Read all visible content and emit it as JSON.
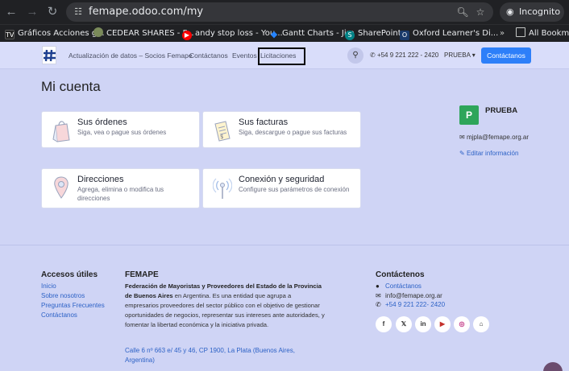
{
  "browser": {
    "url": "femape.odoo.com/my",
    "incognito_label": "Incognito",
    "bookmarks": [
      {
        "label": "Gráficos Acciones g...",
        "icon": "tradingview-icon",
        "color": "#222222"
      },
      {
        "label": "CEDEAR SHARES - P...",
        "icon": "globe-icon",
        "color": "#7a8a5a"
      },
      {
        "label": "andy stop loss - You...",
        "icon": "youtube-icon",
        "color": "#ff0000"
      },
      {
        "label": "Gantt Charts - Jira",
        "icon": "jira-icon",
        "color": "#2684ff"
      },
      {
        "label": "SharePoint",
        "icon": "sharepoint-icon",
        "color": "#038387"
      },
      {
        "label": "Oxford Learner's Di...",
        "icon": "oxford-icon",
        "color": "#1a3a6b"
      }
    ],
    "all_bookmarks_label": "All Bookmark"
  },
  "header": {
    "nav": [
      "Actualización de datos – Socios Femape",
      "Contáctanos",
      "Eventos",
      "Licitaciones"
    ],
    "phone": "+54 9 221 222 - 2420",
    "user": "PRUEBA",
    "cta": "Contáctanos"
  },
  "main": {
    "title": "Mi cuenta",
    "cards": [
      {
        "title": "Sus órdenes",
        "desc": "Siga, vea o pague sus órdenes",
        "icon": "orders-bag-icon"
      },
      {
        "title": "Sus facturas",
        "desc": "Siga, descargue o pague sus facturas",
        "icon": "invoice-icon"
      },
      {
        "title": "Direcciones",
        "desc": "Agrega, elimina o modifica tus direcciones",
        "icon": "map-pin-icon"
      },
      {
        "title": "Conexión y seguridad",
        "desc": "Configure sus parámetros de conexión",
        "icon": "security-antenna-icon"
      }
    ]
  },
  "profile": {
    "initial": "P",
    "name": "PRUEBA",
    "email": "mjpla@femape.org.ar",
    "edit": "Editar información",
    "avatar_color": "#2ea55a"
  },
  "footer": {
    "useful_title": "Accesos útiles",
    "useful_links": [
      "Inicio",
      "Sobre nosotros",
      "Preguntas Frecuentes",
      "Contáctanos"
    ],
    "org_title": "FEMAPE",
    "org_name": "Federación de Mayoristas y Proveedores del Estado de la Provincia de Buenos Aires",
    "org_desc": " en Argentina. Es una entidad que agrupa a empresarios proveedores del sector público con el objetivo de gestionar oportunidades de negocios, representar sus intereses ante autoridades, y fomentar la libertad económica y la iniciativa privada.",
    "address": "Calle 6 nº 663 e/ 45 y 46, CP 1900, La Plata (Buenos Aires, Argentina)",
    "contact_title": "Contáctenos",
    "contact_link": "Contáctanos",
    "contact_email": "info@femape.org.ar",
    "contact_phone": "+54 9 221 222- 2420",
    "social": [
      {
        "icon": "facebook-icon",
        "glyph": "f"
      },
      {
        "icon": "x-icon",
        "glyph": "𝕏"
      },
      {
        "icon": "linkedin-icon",
        "glyph": "in"
      },
      {
        "icon": "youtube-icon",
        "glyph": "▶"
      },
      {
        "icon": "instagram-icon",
        "glyph": "◎"
      },
      {
        "icon": "home-icon",
        "glyph": "⌂"
      }
    ]
  },
  "colors": {
    "accent": "#2d7ff9",
    "page_bg": "#cfd4f5",
    "link": "#2d62c6"
  }
}
